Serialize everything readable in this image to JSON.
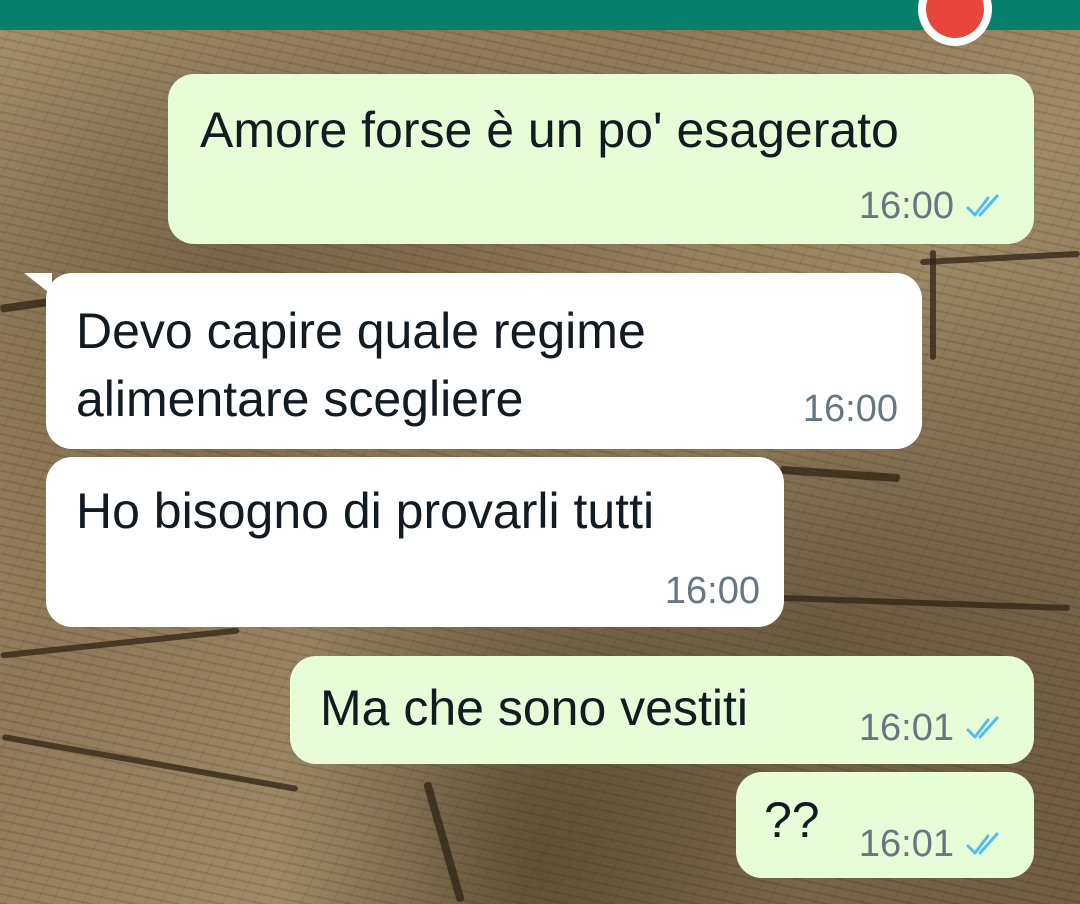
{
  "chat": {
    "messages": [
      {
        "direction": "outgoing",
        "text": "Amore forse è un po' esagerato",
        "time": "16:00",
        "status": "read"
      },
      {
        "direction": "incoming",
        "text": "Devo capire quale regime\nalimentare scegliere",
        "time": "16:00"
      },
      {
        "direction": "incoming",
        "text": "Ho bisogno di provarli tutti",
        "time": "16:00"
      },
      {
        "direction": "outgoing",
        "text": "Ma che sono vestiti",
        "time": "16:01",
        "status": "read"
      },
      {
        "direction": "outgoing",
        "text": "??",
        "time": "16:01",
        "status": "read"
      }
    ]
  },
  "theme": {
    "header_color": "#06806a",
    "outgoing_bubble_color": "#e7fdd7",
    "incoming_bubble_color": "#ffffff",
    "read_tick_color": "#53bdeb",
    "timestamp_color": "#667781"
  },
  "icons": {
    "reaction": "angry-face-emoji-icon",
    "read_receipt": "double-check-icon"
  }
}
